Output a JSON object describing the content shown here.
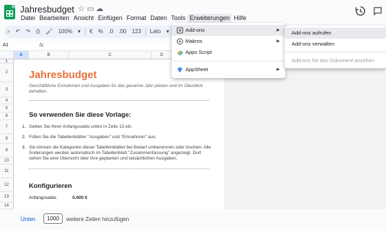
{
  "app": {
    "title": "Jahresbudget",
    "icons": [
      "star-icon",
      "move-to-folder-icon",
      "cloud-status-icon"
    ],
    "menus": [
      "Datei",
      "Bearbeiten",
      "Ansicht",
      "Einfügen",
      "Format",
      "Daten",
      "Tools",
      "Erweiterungen",
      "Hilfe"
    ],
    "active_menu": "Erweiterungen"
  },
  "toolbar": {
    "zoom": "100%",
    "currency": "€",
    "percent": "%",
    "dec_decrease": ".0",
    "dec_increase": ".00",
    "number_format": "123",
    "font": "Lato"
  },
  "formula_bar": {
    "cell_ref": "A1",
    "fx": "fx",
    "value": ""
  },
  "sheet": {
    "columns": [
      "A",
      "B",
      "C",
      "D"
    ],
    "rows": [
      "1",
      "2",
      "3",
      "4",
      "5",
      "6",
      "7",
      "8",
      "9",
      "10",
      "11",
      "12",
      "13",
      "14"
    ],
    "title": "Jahresbudget",
    "subtitle": "Geschäftliche Einnahmen und Ausgaben für das gesamte Jahr planen und im Überblick behalten.",
    "section1": "So verwenden Sie diese Vorlage:",
    "steps": [
      {
        "num": "1.",
        "text": "Geben Sie Ihren Anfangssaldo unten in Zeile 13 ein."
      },
      {
        "num": "2.",
        "text": "Füllen Sie die Tabellenblätter \"Ausgaben\" und \"Einnahmen\" aus."
      },
      {
        "num": "3.",
        "text": "Sie können die Kategorien dieser Tabellenblätter bei Bedarf umbenennen oder löschen. Alle Änderungen werden automatisch im Tabellenblatt \"Zusammenfassung\" angezeigt. Dort sehen Sie eine Übersicht über Ihre geplanten und tatsächlichen Ausgaben."
      }
    ],
    "section2": "Konfigurieren",
    "opening_balance_label": "Anfangssaldo:",
    "opening_balance_value": "5.000 €"
  },
  "bottom": {
    "link": "Unten",
    "rows_value": "1000",
    "rows_label": "weitere Zeilen hinzufügen"
  },
  "extensions_menu": {
    "items": [
      {
        "label": "Add-ons",
        "icon": "addons-icon",
        "submenu": true
      },
      {
        "label": "Makros",
        "icon": "play-circle-icon",
        "submenu": true
      },
      {
        "label": "Apps Script",
        "icon": "apps-script-icon",
        "submenu": false
      },
      {
        "label": "AppSheet",
        "icon": "appsheet-icon",
        "submenu": true
      }
    ]
  },
  "addons_submenu": {
    "items": [
      {
        "label": "Add-ons aufrufen",
        "highlighted": true,
        "disabled": false
      },
      {
        "label": "Add-ons verwalten",
        "highlighted": false,
        "disabled": false
      },
      {
        "label": "Add-ons für das Dokument ansehen",
        "highlighted": false,
        "disabled": true
      }
    ]
  },
  "colors": {
    "accent": "#e8703a",
    "sheets_green": "#0f9d58",
    "link_blue": "#0b57d0"
  }
}
